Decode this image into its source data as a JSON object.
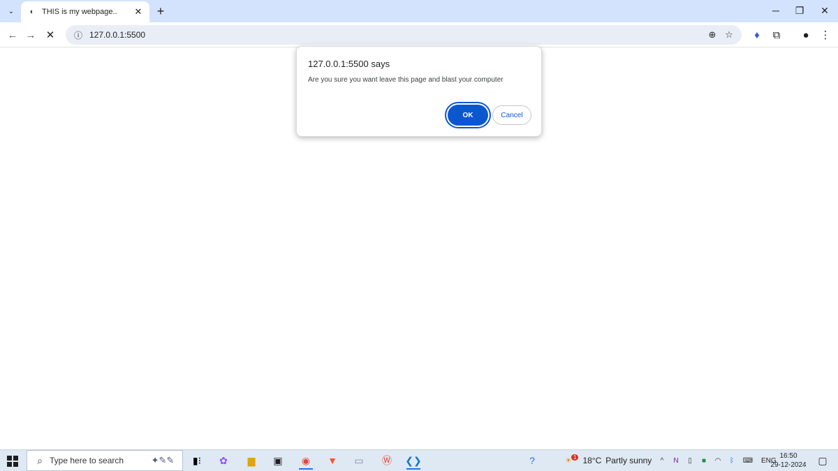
{
  "browser": {
    "tab": {
      "title": "THIS is my webpage.."
    },
    "address": {
      "url": "127.0.0.1:5500"
    }
  },
  "dialog": {
    "title": "127.0.0.1:5500 says",
    "message": "Are you sure you want leave this page and blast your computer",
    "ok_label": "OK",
    "cancel_label": "Cancel"
  },
  "taskbar": {
    "search_placeholder": "Type here to search",
    "weather": {
      "temp": "18°C",
      "desc": "Partly sunny",
      "badge": "1"
    },
    "language": "ENG",
    "time": "16:50",
    "date": "29-12-2024"
  },
  "colors": {
    "chrome_top": "#d3e3fd",
    "accent": "#0b57d0",
    "taskbar": "#dfe9f3"
  }
}
